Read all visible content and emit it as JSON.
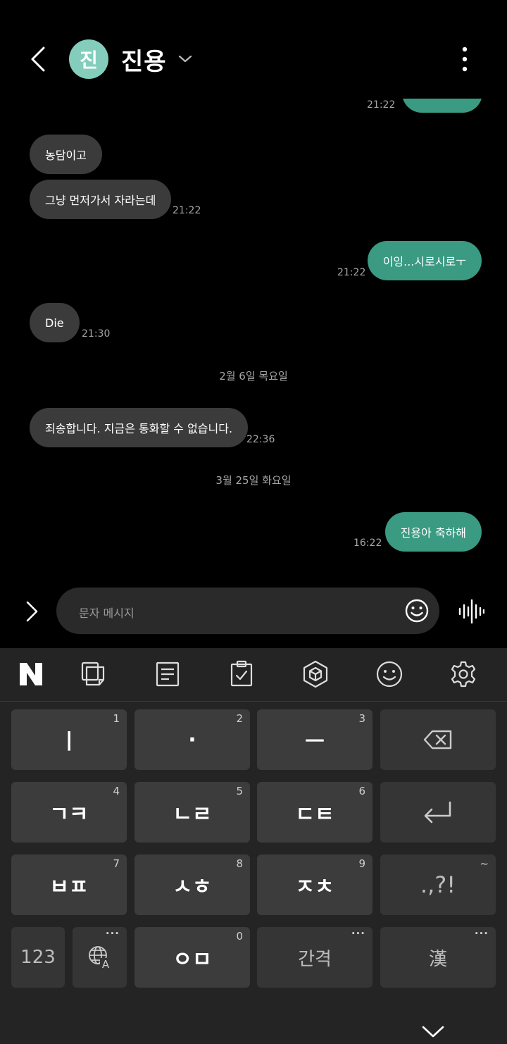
{
  "header": {
    "avatar_initial": "진",
    "contact_name": "진용"
  },
  "messages": [
    {
      "id": "m0",
      "direction": "out",
      "text": "",
      "time": "21:22"
    },
    {
      "id": "m1",
      "direction": "in",
      "text": "농담이고",
      "time": ""
    },
    {
      "id": "m2",
      "direction": "in",
      "text": "그냥 먼저가서 자라는데",
      "time": "21:22"
    },
    {
      "id": "m3",
      "direction": "out",
      "text": "이잉...시로시로ㅜ",
      "time": "21:22"
    },
    {
      "id": "m4",
      "direction": "in",
      "text": "Die",
      "time": "21:30"
    },
    {
      "id": "d1",
      "date": "2월 6일 목요일"
    },
    {
      "id": "m5",
      "direction": "in",
      "text": "죄송합니다. 지금은 통화할 수 없습니다.",
      "time": "22:36"
    },
    {
      "id": "d2",
      "date": "3월 25일 화요일"
    },
    {
      "id": "m6",
      "direction": "out",
      "text": "진용아 축하해",
      "time": "16:22"
    }
  ],
  "composer": {
    "placeholder": "문자 메시지"
  },
  "keyboard": {
    "toolbar": [
      "naver-logo-icon",
      "clipboard-icon",
      "notes-icon",
      "checklist-icon",
      "cube-icon",
      "emoji-icon",
      "settings-icon"
    ],
    "rows": [
      [
        {
          "label": "ㅣ",
          "num": "1"
        },
        {
          "label": "·",
          "num": "2"
        },
        {
          "label": "ㅡ",
          "num": "3"
        },
        {
          "label": "",
          "icon": "backspace-icon"
        }
      ],
      [
        {
          "label": "ㄱㅋ",
          "num": "4"
        },
        {
          "label": "ㄴㄹ",
          "num": "5"
        },
        {
          "label": "ㄷㅌ",
          "num": "6"
        },
        {
          "label": "",
          "icon": "enter-icon"
        }
      ],
      [
        {
          "label": "ㅂㅍ",
          "num": "7"
        },
        {
          "label": "ㅅㅎ",
          "num": "8"
        },
        {
          "label": "ㅈㅊ",
          "num": "9"
        },
        {
          "label": ".,?!",
          "num": "~"
        }
      ],
      [
        {
          "label": "123"
        },
        {
          "label": "",
          "icon": "language-icon"
        },
        {
          "label": "ㅇㅁ",
          "num": "0"
        },
        {
          "label": "간격"
        },
        {
          "label": "漢"
        }
      ]
    ]
  },
  "colors": {
    "outgoing_bubble": "#3a9a82",
    "incoming_bubble": "#3b3b3b",
    "avatar": "#84cdbd",
    "keyboard_bg": "#242424"
  }
}
